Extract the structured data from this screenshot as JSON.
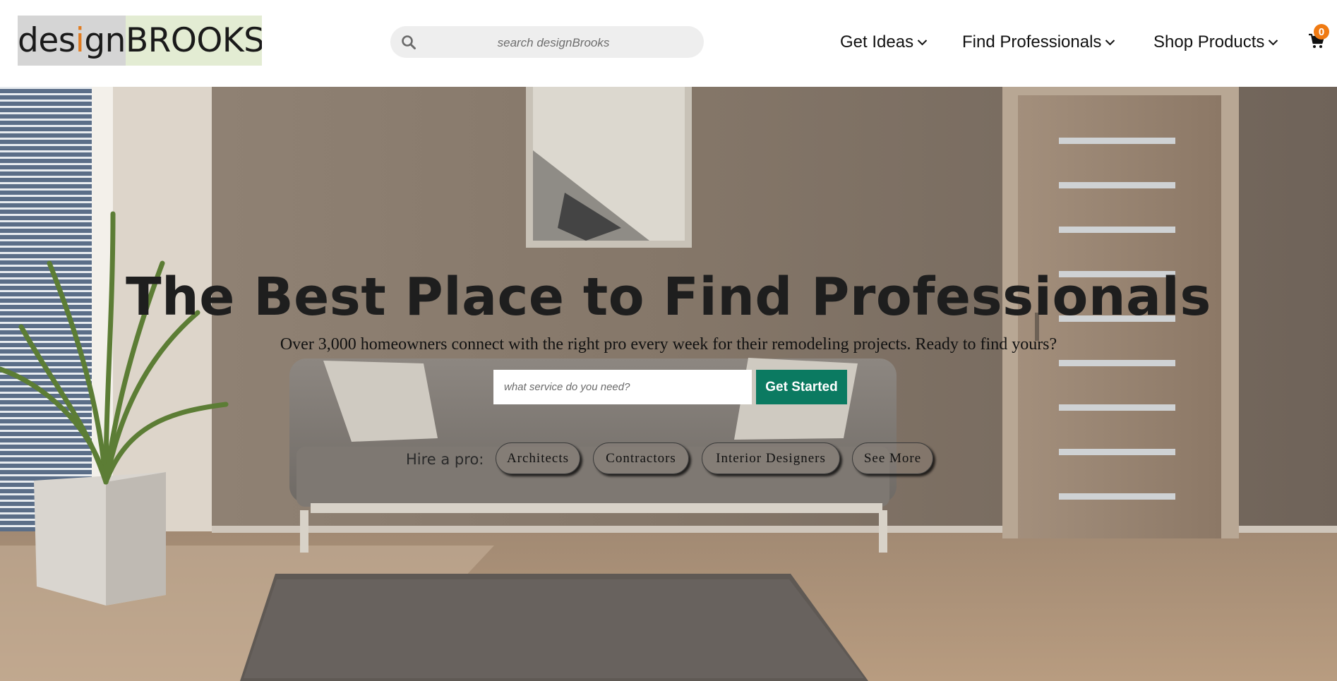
{
  "brand": {
    "logo_part1_a": "des",
    "logo_part1_i": "i",
    "logo_part1_b": "gn",
    "logo_part2": "BROOKS"
  },
  "header": {
    "search_placeholder": "search designBrooks",
    "nav": [
      {
        "label": "Get Ideas"
      },
      {
        "label": "Find Professionals"
      },
      {
        "label": "Shop Products"
      }
    ],
    "cart_count": "0"
  },
  "hero": {
    "title": "The Best Place to Find Professionals",
    "subtitle": "Over 3,000 homeowners connect with the right pro every week for their remodeling projects. Ready to find yours?",
    "service_placeholder": "what service do you need?",
    "cta_label": "Get Started",
    "hire_label": "Hire a pro:",
    "pills": [
      {
        "label": "Architects"
      },
      {
        "label": "Contractors"
      },
      {
        "label": "Interior Designers"
      },
      {
        "label": "See More"
      }
    ]
  },
  "colors": {
    "accent_green": "#0b7a61",
    "badge_orange": "#f07a12",
    "logo_left_bg": "#d5d5d5",
    "logo_right_bg": "#e3ecd3"
  },
  "icons": {
    "search": "search-icon",
    "chevron": "chevron-down-icon",
    "cart": "cart-icon"
  }
}
